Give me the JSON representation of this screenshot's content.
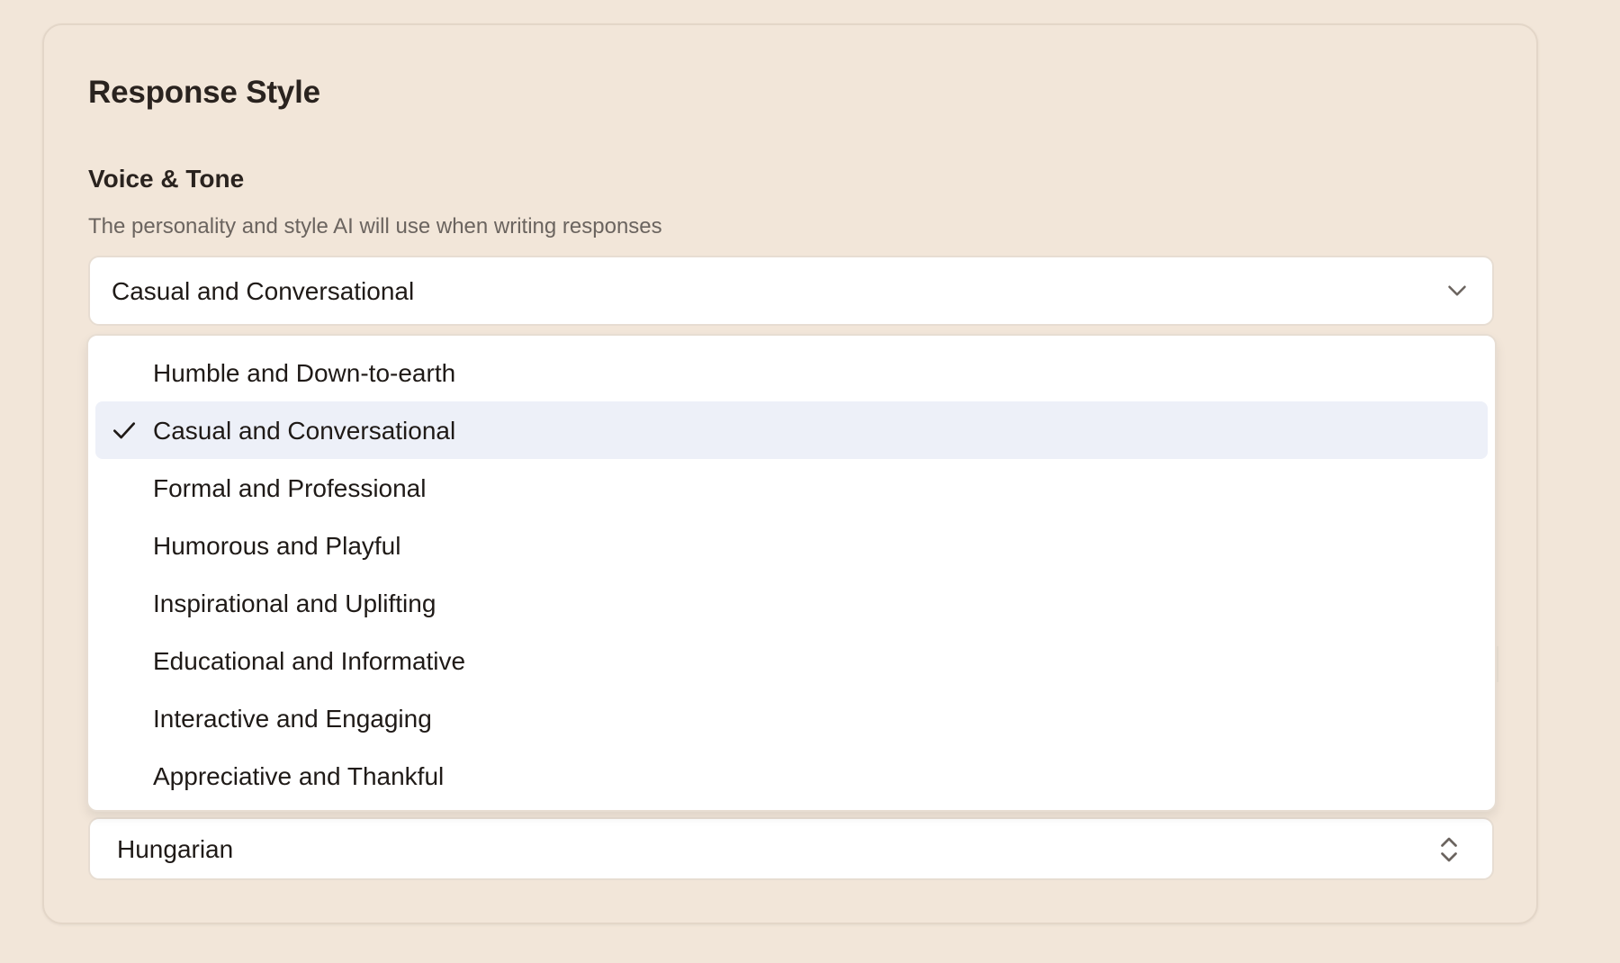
{
  "card": {
    "title": "Response Style"
  },
  "voice_tone": {
    "label": "Voice & Tone",
    "description": "The personality and style AI will use when writing responses",
    "selected_value": "Casual and Conversational",
    "options": [
      {
        "label": "Humble and Down-to-earth",
        "selected": false
      },
      {
        "label": "Casual and Conversational",
        "selected": true
      },
      {
        "label": "Formal and Professional",
        "selected": false
      },
      {
        "label": "Humorous and Playful",
        "selected": false
      },
      {
        "label": "Inspirational and Uplifting",
        "selected": false
      },
      {
        "label": "Educational and Informative",
        "selected": false
      },
      {
        "label": "Interactive and Engaging",
        "selected": false
      },
      {
        "label": "Appreciative and Thankful",
        "selected": false
      }
    ]
  },
  "language": {
    "selected_value": "Hungarian"
  },
  "icons": {
    "select_chevron": "chevron-down-icon",
    "language_select": "chevron-up-down-icon",
    "selected_option": "check-icon"
  },
  "colors": {
    "page_background": "#f2e6d9",
    "selected_option_background": "#edf0f8",
    "text_primary": "#1f1a17",
    "text_secondary": "#6b645f"
  }
}
